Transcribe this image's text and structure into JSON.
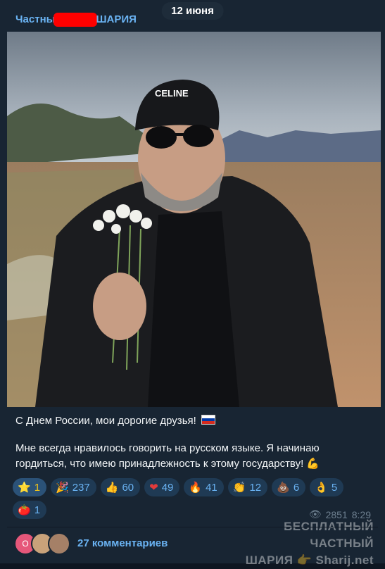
{
  "date_label": "12 июня",
  "channel": {
    "name_start": "Частны",
    "name_end": "ШАРИЯ"
  },
  "photo": {
    "cap_text": "CELINE"
  },
  "post": {
    "line1": "С Днем России, мои дорогие друзья!",
    "line2": "Мне всегда нравилось говорить на русском языке. Я начинаю гордиться, что имею принадлежность к этому государству!"
  },
  "reactions": [
    {
      "emoji": "⭐",
      "count": "1"
    },
    {
      "emoji": "🎉",
      "count": "237"
    },
    {
      "emoji": "👍",
      "count": "60"
    },
    {
      "emoji": "❤",
      "count": "49"
    },
    {
      "emoji": "🔥",
      "count": "41"
    },
    {
      "emoji": "👏",
      "count": "12"
    },
    {
      "emoji": "💩",
      "count": "6"
    },
    {
      "emoji": "👌",
      "count": "5"
    },
    {
      "emoji": "🍅",
      "count": "1"
    }
  ],
  "meta": {
    "views": "2851",
    "time": "8:29"
  },
  "comments": {
    "avatar_letter": "О",
    "label": "27 комментариев"
  },
  "watermark": {
    "line1": "БЕСПЛАТНЫЙ ЧАСТНЫЙ",
    "line2": "ШАРИЯ 👉 Sharij.net"
  },
  "colors": {
    "background": "#0e1621",
    "bubble": "#182533",
    "accent": "#6ab3f3",
    "chip": "#1f3a54"
  }
}
